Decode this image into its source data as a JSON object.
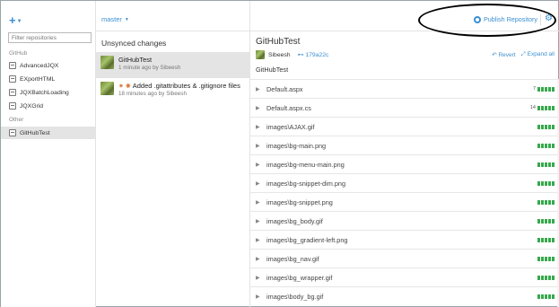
{
  "window": {
    "controls": [
      "+",
      "×"
    ]
  },
  "sidebar": {
    "add_label": "+",
    "filter_placeholder": "Filter repositories",
    "groups": [
      {
        "label": "GitHub",
        "items": [
          "AdvancedJQX",
          "EXportHTML",
          "JQXBatchLoading",
          "JQXGrid"
        ]
      },
      {
        "label": "Other",
        "items": [
          "GitHubTest"
        ]
      }
    ],
    "selected": "GitHubTest"
  },
  "middle": {
    "branch": "master",
    "heading": "Unsynced changes",
    "commits": [
      {
        "title": "GitHubTest",
        "meta": "1 minute ago by Sibeesh",
        "selected": true
      },
      {
        "title": "Added .gitattributes & .gitignore files",
        "meta": "18 minutes ago by Sibeesh",
        "selected": false
      }
    ]
  },
  "right": {
    "publish_label": "Publish Repository",
    "commit_title": "GitHubTest",
    "author": "Sibeesh",
    "sha": "179a22c",
    "revert_label": "Revert",
    "expand_label": "Expand all",
    "description": "GitHubTest",
    "files": [
      {
        "name": "Default.aspx",
        "additions": "7"
      },
      {
        "name": "Default.aspx.cs",
        "additions": "14"
      },
      {
        "name": "images\\AJAX.gif",
        "additions": ""
      },
      {
        "name": "images\\bg-main.png",
        "additions": ""
      },
      {
        "name": "images\\bg-menu-main.png",
        "additions": ""
      },
      {
        "name": "images\\bg-snippet-dim.png",
        "additions": ""
      },
      {
        "name": "images\\bg-snippet.png",
        "additions": ""
      },
      {
        "name": "images\\bg_body.gif",
        "additions": ""
      },
      {
        "name": "images\\bg_gradient-left.png",
        "additions": ""
      },
      {
        "name": "images\\bg_nav.gif",
        "additions": ""
      },
      {
        "name": "images\\bg_wrapper.gif",
        "additions": ""
      },
      {
        "name": "images\\body_bg.gif",
        "additions": ""
      }
    ]
  },
  "colors": {
    "accent": "#3b8fd1",
    "additions": "#37a94d",
    "selected_bg": "#e4e4e4"
  }
}
